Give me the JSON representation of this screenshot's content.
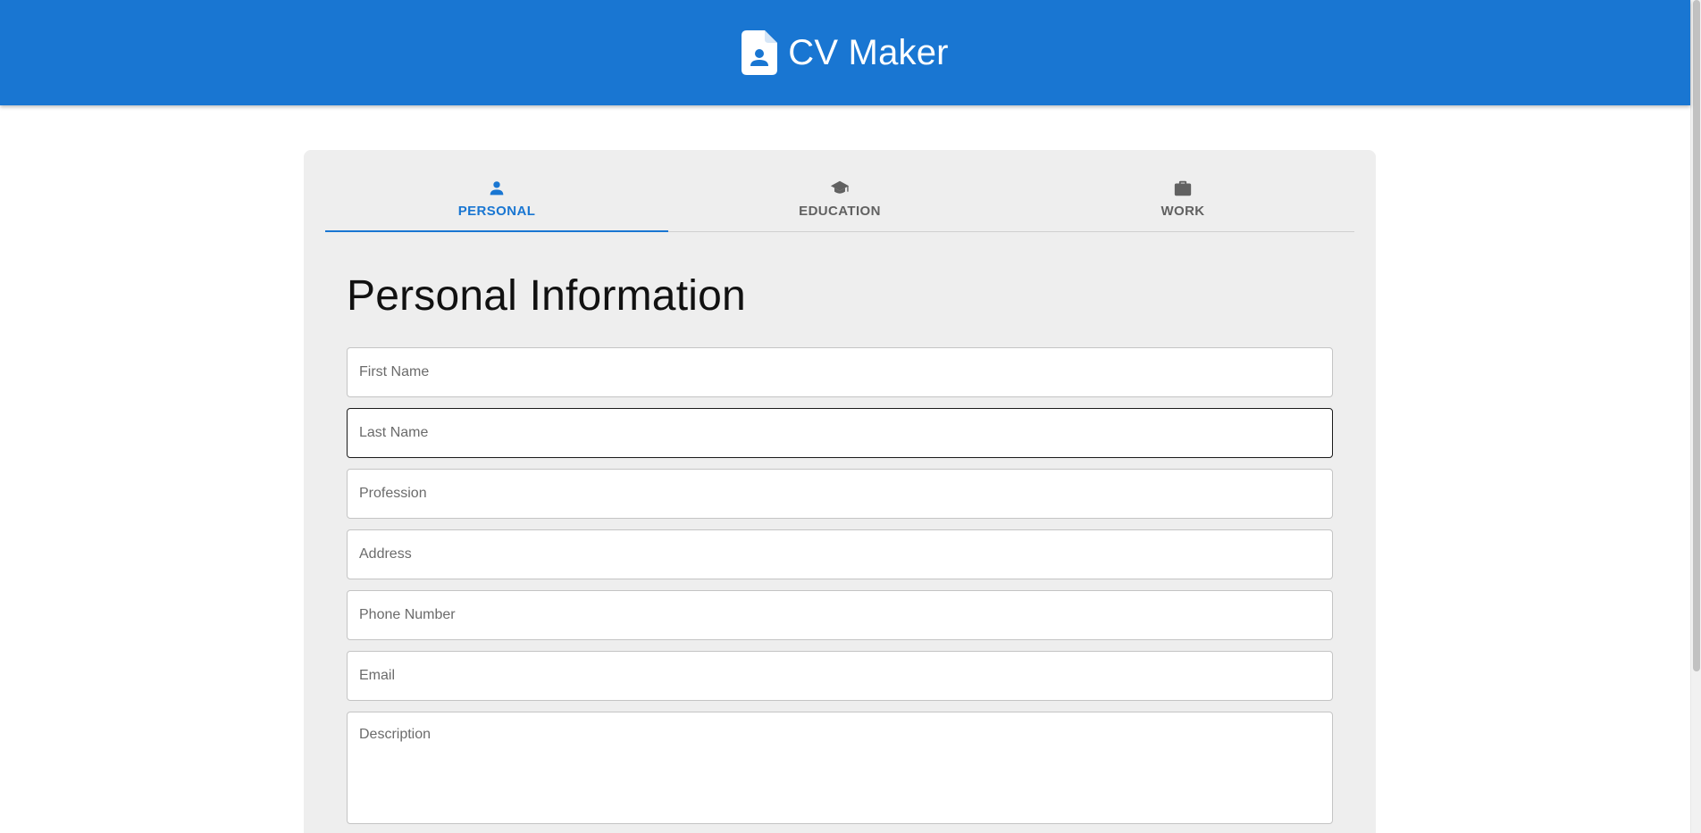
{
  "header": {
    "title": "CV Maker",
    "icon": "contact-document-icon",
    "background_color": "#1976d2"
  },
  "tabs": [
    {
      "label": "PERSONAL",
      "icon": "person-icon",
      "active": true
    },
    {
      "label": "EDUCATION",
      "icon": "graduation-cap-icon",
      "active": false
    },
    {
      "label": "WORK",
      "icon": "briefcase-icon",
      "active": false
    }
  ],
  "personal": {
    "title": "Personal Information",
    "fields": {
      "first_name": {
        "placeholder": "First Name",
        "value": ""
      },
      "last_name": {
        "placeholder": "Last Name",
        "value": ""
      },
      "profession": {
        "placeholder": "Profession",
        "value": ""
      },
      "address": {
        "placeholder": "Address",
        "value": ""
      },
      "phone": {
        "placeholder": "Phone Number",
        "value": ""
      },
      "email": {
        "placeholder": "Email",
        "value": ""
      },
      "description": {
        "placeholder": "Description",
        "value": ""
      }
    }
  },
  "colors": {
    "accent": "#1976d2",
    "card_background": "#eeeeee",
    "inactive_tab": "#616161"
  }
}
